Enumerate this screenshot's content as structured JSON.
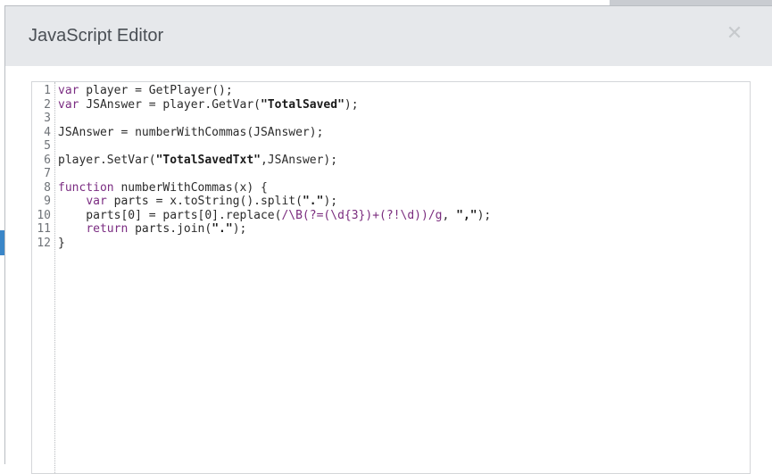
{
  "dialog": {
    "title": "JavaScript Editor",
    "close_icon": "close-icon"
  },
  "editor": {
    "lines": [
      {
        "n": "1",
        "segments": [
          {
            "t": "kw",
            "v": "var"
          },
          {
            "t": "txt",
            "v": " player = GetPlayer();"
          }
        ]
      },
      {
        "n": "2",
        "segments": [
          {
            "t": "kw",
            "v": "var"
          },
          {
            "t": "txt",
            "v": " JSAnswer = player.GetVar("
          },
          {
            "t": "str",
            "v": "\"TotalSaved\""
          },
          {
            "t": "txt",
            "v": ");"
          }
        ]
      },
      {
        "n": "3",
        "segments": []
      },
      {
        "n": "4",
        "segments": [
          {
            "t": "txt",
            "v": "JSAnswer = numberWithCommas(JSAnswer);"
          }
        ]
      },
      {
        "n": "5",
        "segments": []
      },
      {
        "n": "6",
        "segments": [
          {
            "t": "txt",
            "v": "player.SetVar("
          },
          {
            "t": "str",
            "v": "\"TotalSavedTxt\""
          },
          {
            "t": "txt",
            "v": ",JSAnswer);"
          }
        ]
      },
      {
        "n": "7",
        "segments": []
      },
      {
        "n": "8",
        "segments": [
          {
            "t": "kw",
            "v": "function"
          },
          {
            "t": "txt",
            "v": " numberWithCommas(x) {"
          }
        ]
      },
      {
        "n": "9",
        "segments": [
          {
            "t": "txt",
            "v": "    "
          },
          {
            "t": "kw",
            "v": "var"
          },
          {
            "t": "txt",
            "v": " parts = x.toString().split("
          },
          {
            "t": "str",
            "v": "\".\""
          },
          {
            "t": "txt",
            "v": ");"
          }
        ]
      },
      {
        "n": "10",
        "segments": [
          {
            "t": "txt",
            "v": "    parts[0] = parts[0].replace("
          },
          {
            "t": "rx",
            "v": "/\\B(?=(\\d{3})+(?!\\d))/g"
          },
          {
            "t": "txt",
            "v": ", "
          },
          {
            "t": "str",
            "v": "\",\""
          },
          {
            "t": "txt",
            "v": ");"
          }
        ]
      },
      {
        "n": "11",
        "segments": [
          {
            "t": "txt",
            "v": "    "
          },
          {
            "t": "kw",
            "v": "return"
          },
          {
            "t": "txt",
            "v": " parts.join("
          },
          {
            "t": "str",
            "v": "\".\""
          },
          {
            "t": "txt",
            "v": ");"
          }
        ]
      },
      {
        "n": "12",
        "segments": [
          {
            "t": "txt",
            "v": "}"
          }
        ]
      }
    ]
  },
  "colors": {
    "titlebar_bg": "#e6e8eb",
    "keyword": "#7b2d82",
    "text": "#2b2b2b"
  }
}
